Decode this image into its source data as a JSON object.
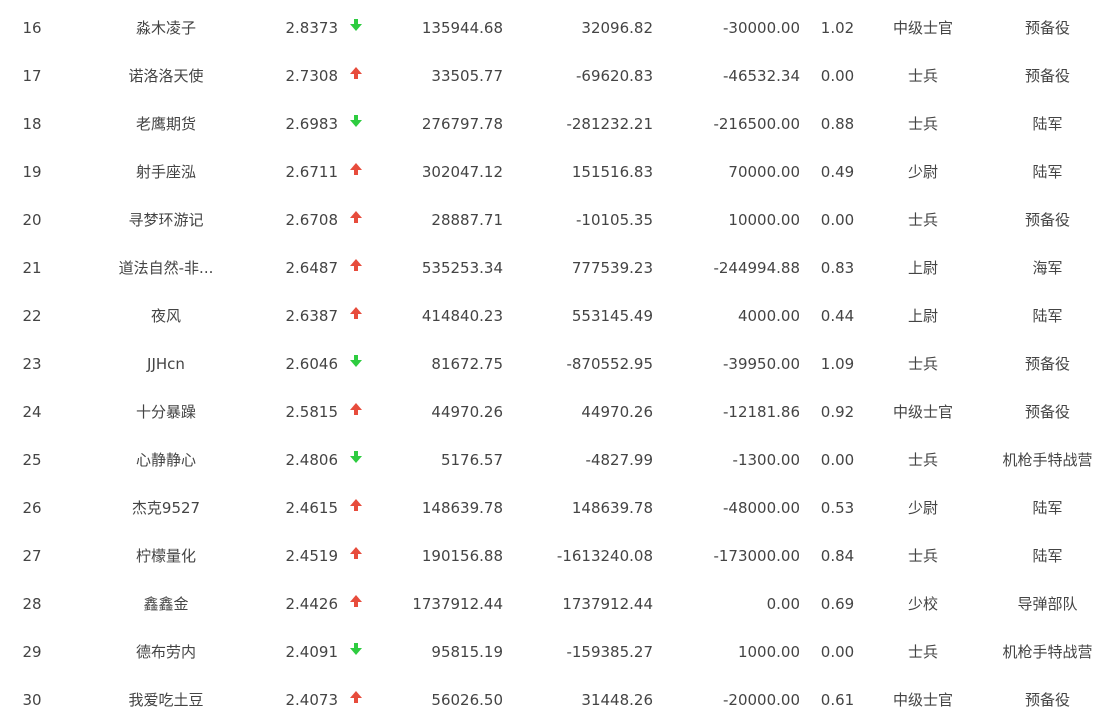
{
  "colors": {
    "up": "#e74c3c",
    "down": "#2ecc40",
    "text": "#444444"
  },
  "rows": [
    {
      "rank": "16",
      "name": "淼木凌子",
      "score": "2.8373",
      "trend": "down",
      "v1": "135944.68",
      "v2": "32096.82",
      "v3": "-30000.00",
      "ratio": "1.02",
      "military_rank": "中级士官",
      "unit": "预备役"
    },
    {
      "rank": "17",
      "name": "诺洛洛天使",
      "score": "2.7308",
      "trend": "up",
      "v1": "33505.77",
      "v2": "-69620.83",
      "v3": "-46532.34",
      "ratio": "0.00",
      "military_rank": "士兵",
      "unit": "预备役"
    },
    {
      "rank": "18",
      "name": "老鹰期货",
      "score": "2.6983",
      "trend": "down",
      "v1": "276797.78",
      "v2": "-281232.21",
      "v3": "-216500.00",
      "ratio": "0.88",
      "military_rank": "士兵",
      "unit": "陆军"
    },
    {
      "rank": "19",
      "name": "射手座泓",
      "score": "2.6711",
      "trend": "up",
      "v1": "302047.12",
      "v2": "151516.83",
      "v3": "70000.00",
      "ratio": "0.49",
      "military_rank": "少尉",
      "unit": "陆军"
    },
    {
      "rank": "20",
      "name": "寻梦环游记",
      "score": "2.6708",
      "trend": "up",
      "v1": "28887.71",
      "v2": "-10105.35",
      "v3": "10000.00",
      "ratio": "0.00",
      "military_rank": "士兵",
      "unit": "预备役"
    },
    {
      "rank": "21",
      "name": "道法自然-非...",
      "score": "2.6487",
      "trend": "up",
      "v1": "535253.34",
      "v2": "777539.23",
      "v3": "-244994.88",
      "ratio": "0.83",
      "military_rank": "上尉",
      "unit": "海军"
    },
    {
      "rank": "22",
      "name": "夜风",
      "score": "2.6387",
      "trend": "up",
      "v1": "414840.23",
      "v2": "553145.49",
      "v3": "4000.00",
      "ratio": "0.44",
      "military_rank": "上尉",
      "unit": "陆军"
    },
    {
      "rank": "23",
      "name": "JJHcn",
      "score": "2.6046",
      "trend": "down",
      "v1": "81672.75",
      "v2": "-870552.95",
      "v3": "-39950.00",
      "ratio": "1.09",
      "military_rank": "士兵",
      "unit": "预备役"
    },
    {
      "rank": "24",
      "name": "十分暴躁",
      "score": "2.5815",
      "trend": "up",
      "v1": "44970.26",
      "v2": "44970.26",
      "v3": "-12181.86",
      "ratio": "0.92",
      "military_rank": "中级士官",
      "unit": "预备役"
    },
    {
      "rank": "25",
      "name": "心静静心",
      "score": "2.4806",
      "trend": "down",
      "v1": "5176.57",
      "v2": "-4827.99",
      "v3": "-1300.00",
      "ratio": "0.00",
      "military_rank": "士兵",
      "unit": "机枪手特战营"
    },
    {
      "rank": "26",
      "name": "杰克9527",
      "score": "2.4615",
      "trend": "up",
      "v1": "148639.78",
      "v2": "148639.78",
      "v3": "-48000.00",
      "ratio": "0.53",
      "military_rank": "少尉",
      "unit": "陆军"
    },
    {
      "rank": "27",
      "name": "柠檬量化",
      "score": "2.4519",
      "trend": "up",
      "v1": "190156.88",
      "v2": "-1613240.08",
      "v3": "-173000.00",
      "ratio": "0.84",
      "military_rank": "士兵",
      "unit": "陆军"
    },
    {
      "rank": "28",
      "name": "鑫鑫金",
      "score": "2.4426",
      "trend": "up",
      "v1": "1737912.44",
      "v2": "1737912.44",
      "v3": "0.00",
      "ratio": "0.69",
      "military_rank": "少校",
      "unit": "导弹部队"
    },
    {
      "rank": "29",
      "name": "德布劳内",
      "score": "2.4091",
      "trend": "down",
      "v1": "95815.19",
      "v2": "-159385.27",
      "v3": "1000.00",
      "ratio": "0.00",
      "military_rank": "士兵",
      "unit": "机枪手特战营"
    },
    {
      "rank": "30",
      "name": "我爱吃土豆",
      "score": "2.4073",
      "trend": "up",
      "v1": "56026.50",
      "v2": "31448.26",
      "v3": "-20000.00",
      "ratio": "0.61",
      "military_rank": "中级士官",
      "unit": "预备役"
    }
  ]
}
